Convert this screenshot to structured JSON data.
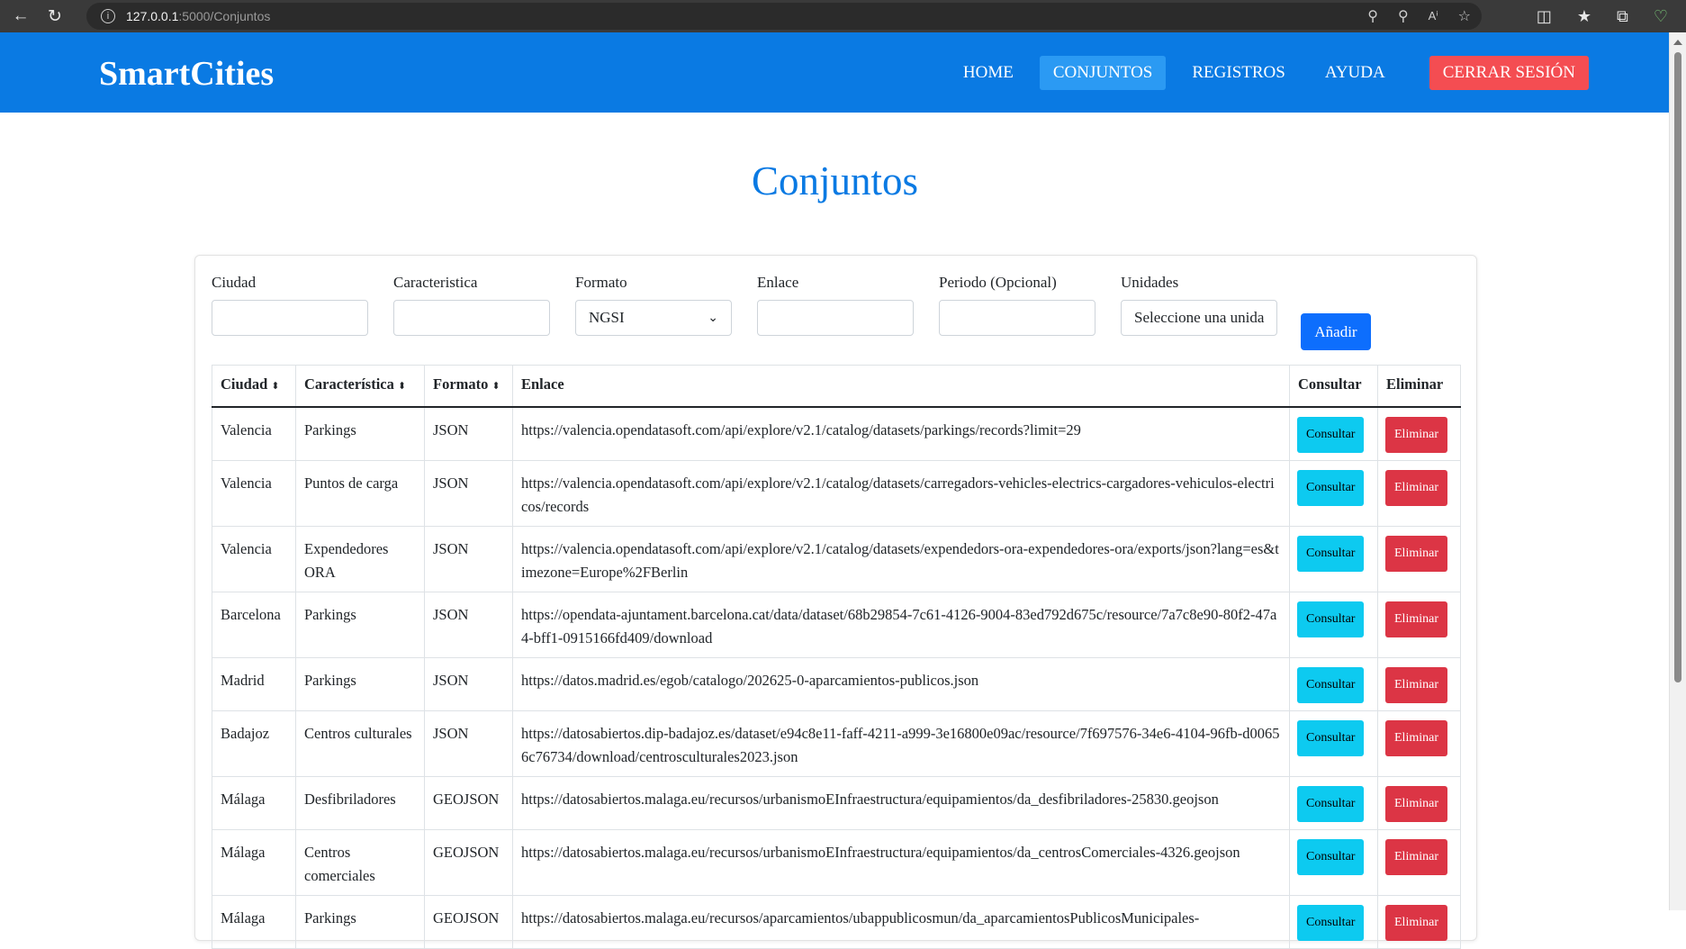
{
  "browser": {
    "url_host": "127.0.0.1",
    "url_path": ":5000/Conjuntos"
  },
  "navbar": {
    "brand": "SmartCities",
    "links": [
      {
        "label": "HOME"
      },
      {
        "label": "CONJUNTOS",
        "active": true
      },
      {
        "label": "REGISTROS"
      },
      {
        "label": "AYUDA"
      },
      {
        "label": "CERRAR SESIÓN"
      }
    ]
  },
  "page": {
    "title": "Conjuntos"
  },
  "form": {
    "ciudad_label": "Ciudad",
    "caracteristica_label": "Caracteristica",
    "formato_label": "Formato",
    "formato_value": "NGSI",
    "enlace_label": "Enlace",
    "periodo_label": "Periodo (Opcional)",
    "unidades_label": "Unidades",
    "unidades_value": "Seleccione una unida",
    "add_button": "Añadir"
  },
  "table": {
    "headers": [
      "Ciudad",
      "Característica",
      "Formato",
      "Enlace",
      "Consultar",
      "Eliminar"
    ],
    "consultar_label": "Consultar",
    "eliminar_label": "Eliminar",
    "rows": [
      {
        "ciudad": "Valencia",
        "caracteristica": "Parkings",
        "formato": "JSON",
        "enlace": "https://valencia.opendatasoft.com/api/explore/v2.1/catalog/datasets/parkings/records?limit=29"
      },
      {
        "ciudad": "Valencia",
        "caracteristica": "Puntos de carga",
        "formato": "JSON",
        "enlace": "https://valencia.opendatasoft.com/api/explore/v2.1/catalog/datasets/carregadors-vehicles-electrics-cargadores-vehiculos-electricos/records"
      },
      {
        "ciudad": "Valencia",
        "caracteristica": "Expendedores ORA",
        "formato": "JSON",
        "enlace": "https://valencia.opendatasoft.com/api/explore/v2.1/catalog/datasets/expendedors-ora-expendedores-ora/exports/json?lang=es&timezone=Europe%2FBerlin"
      },
      {
        "ciudad": "Barcelona",
        "caracteristica": "Parkings",
        "formato": "JSON",
        "enlace": "https://opendata-ajuntament.barcelona.cat/data/dataset/68b29854-7c61-4126-9004-83ed792d675c/resource/7a7c8e90-80f2-47a4-bff1-0915166fd409/download"
      },
      {
        "ciudad": "Madrid",
        "caracteristica": "Parkings",
        "formato": "JSON",
        "enlace": "https://datos.madrid.es/egob/catalogo/202625-0-aparcamientos-publicos.json"
      },
      {
        "ciudad": "Badajoz",
        "caracteristica": "Centros culturales",
        "formato": "JSON",
        "enlace": "https://datosabiertos.dip-badajoz.es/dataset/e94c8e11-faff-4211-a999-3e16800e09ac/resource/7f697576-34e6-4104-96fb-d00656c76734/download/centrosculturales2023.json"
      },
      {
        "ciudad": "Málaga",
        "caracteristica": "Desfibriladores",
        "formato": "GEOJSON",
        "enlace": "https://datosabiertos.malaga.eu/recursos/urbanismoEInfraestructura/equipamientos/da_desfibriladores-25830.geojson"
      },
      {
        "ciudad": "Málaga",
        "caracteristica": "Centros comerciales",
        "formato": "GEOJSON",
        "enlace": "https://datosabiertos.malaga.eu/recursos/urbanismoEInfraestructura/equipamientos/da_centrosComerciales-4326.geojson"
      },
      {
        "ciudad": "Málaga",
        "caracteristica": "Parkings",
        "formato": "GEOJSON",
        "enlace": "https://datosabiertos.malaga.eu/recursos/aparcamientos/ubappublicosmun/da_aparcamientosPublicosMunicipales-"
      }
    ]
  }
}
